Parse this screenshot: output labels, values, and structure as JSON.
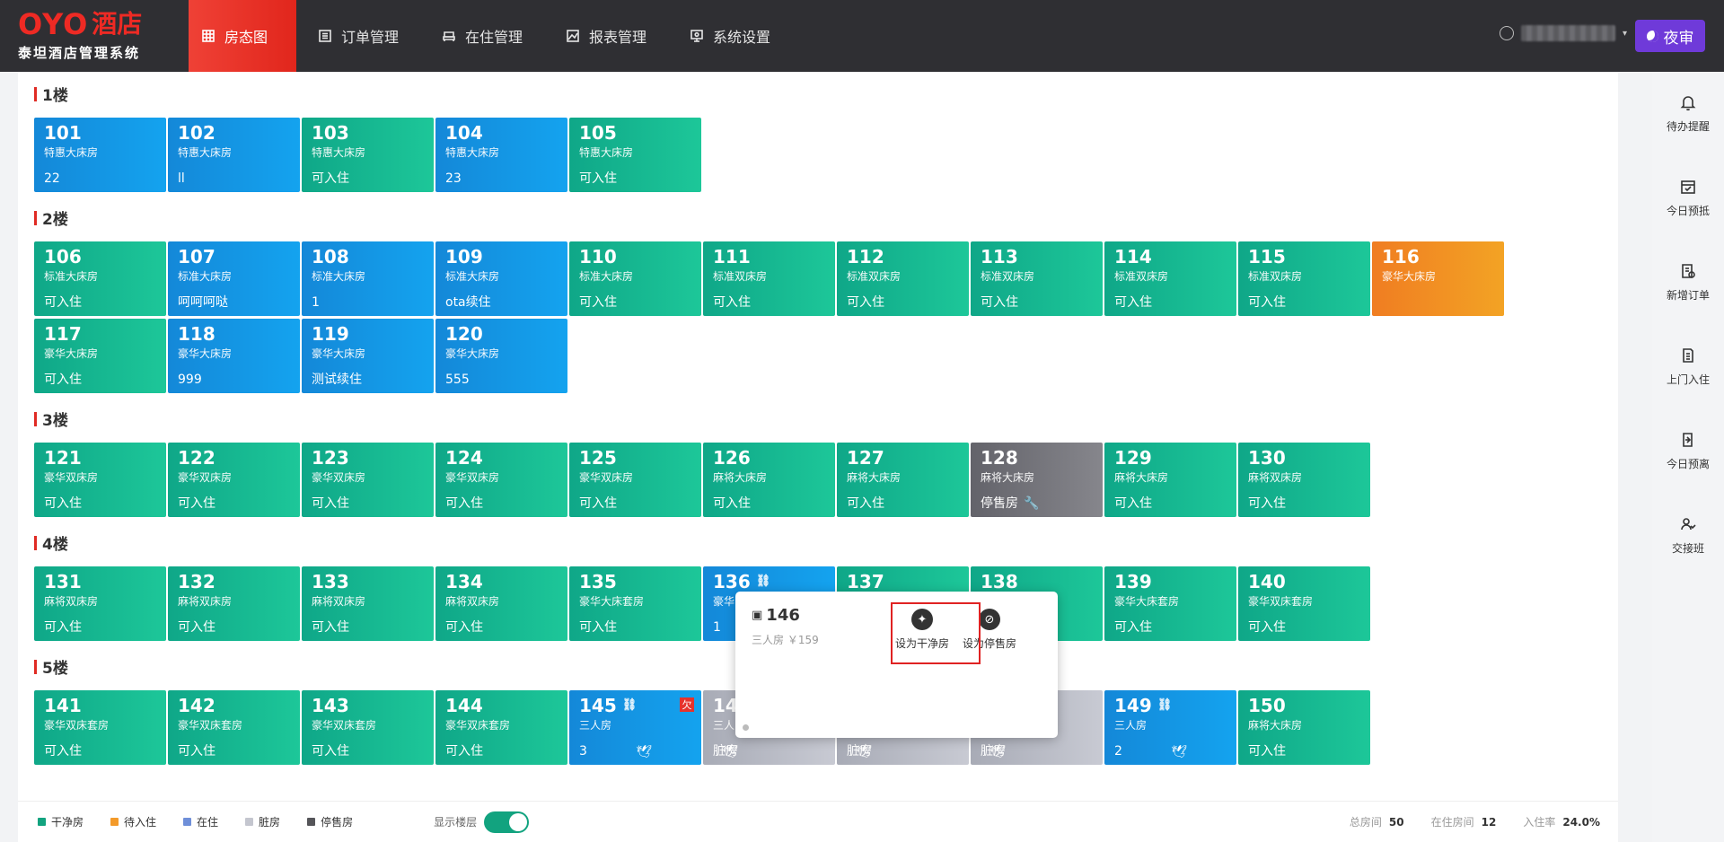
{
  "brand": {
    "oyo": "OYO",
    "hotel": "酒店",
    "sub": "泰坦酒店管理系统"
  },
  "nav": [
    {
      "label": "房态图",
      "icon": "grid-icon",
      "active": true
    },
    {
      "label": "订单管理",
      "icon": "list-icon"
    },
    {
      "label": "在住管理",
      "icon": "bed-icon"
    },
    {
      "label": "报表管理",
      "icon": "chart-icon"
    },
    {
      "label": "系统设置",
      "icon": "settings-icon"
    }
  ],
  "user": {
    "caret": "▾"
  },
  "night_button": "夜审",
  "floors": [
    {
      "title": "1楼",
      "rooms": [
        {
          "num": "101",
          "type": "特惠大床房",
          "status": "22",
          "color": "b"
        },
        {
          "num": "102",
          "type": "特惠大床房",
          "status": "ll",
          "color": "b"
        },
        {
          "num": "103",
          "type": "特惠大床房",
          "status": "可入住",
          "color": "g"
        },
        {
          "num": "104",
          "type": "特惠大床房",
          "status": "23",
          "color": "b"
        },
        {
          "num": "105",
          "type": "特惠大床房",
          "status": "可入住",
          "color": "g"
        }
      ]
    },
    {
      "title": "2楼",
      "rooms": [
        {
          "num": "106",
          "type": "标准大床房",
          "status": "可入住",
          "color": "g"
        },
        {
          "num": "107",
          "type": "标准大床房",
          "status": "呵呵呵哒",
          "color": "b"
        },
        {
          "num": "108",
          "type": "标准大床房",
          "status": "1",
          "color": "b"
        },
        {
          "num": "109",
          "type": "标准大床房",
          "status": "ota续住",
          "color": "b"
        },
        {
          "num": "110",
          "type": "标准大床房",
          "status": "可入住",
          "color": "g"
        },
        {
          "num": "111",
          "type": "标准双床房",
          "status": "可入住",
          "color": "g"
        },
        {
          "num": "112",
          "type": "标准双床房",
          "status": "可入住",
          "color": "g"
        },
        {
          "num": "113",
          "type": "标准双床房",
          "status": "可入住",
          "color": "g"
        },
        {
          "num": "114",
          "type": "标准双床房",
          "status": "可入住",
          "color": "g"
        },
        {
          "num": "115",
          "type": "标准双床房",
          "status": "可入住",
          "color": "g"
        },
        {
          "num": "116",
          "type": "豪华大床房",
          "status": "",
          "color": "o"
        },
        {
          "num": "117",
          "type": "豪华大床房",
          "status": "可入住",
          "color": "g"
        },
        {
          "num": "118",
          "type": "豪华大床房",
          "status": "999",
          "color": "b"
        },
        {
          "num": "119",
          "type": "豪华大床房",
          "status": "测试续住",
          "color": "b"
        },
        {
          "num": "120",
          "type": "豪华大床房",
          "status": "555",
          "color": "b"
        }
      ]
    },
    {
      "title": "3楼",
      "rooms": [
        {
          "num": "121",
          "type": "豪华双床房",
          "status": "可入住",
          "color": "g"
        },
        {
          "num": "122",
          "type": "豪华双床房",
          "status": "可入住",
          "color": "g"
        },
        {
          "num": "123",
          "type": "豪华双床房",
          "status": "可入住",
          "color": "g"
        },
        {
          "num": "124",
          "type": "豪华双床房",
          "status": "可入住",
          "color": "g"
        },
        {
          "num": "125",
          "type": "豪华双床房",
          "status": "可入住",
          "color": "g"
        },
        {
          "num": "126",
          "type": "麻将大床房",
          "status": "可入住",
          "color": "g"
        },
        {
          "num": "127",
          "type": "麻将大床房",
          "status": "可入住",
          "color": "g"
        },
        {
          "num": "128",
          "type": "麻将大床房",
          "status": "停售房",
          "color": "d",
          "wrench": true
        },
        {
          "num": "129",
          "type": "麻将大床房",
          "status": "可入住",
          "color": "g"
        },
        {
          "num": "130",
          "type": "麻将双床房",
          "status": "可入住",
          "color": "g"
        }
      ]
    },
    {
      "title": "4楼",
      "rooms": [
        {
          "num": "131",
          "type": "麻将双床房",
          "status": "可入住",
          "color": "g"
        },
        {
          "num": "132",
          "type": "麻将双床房",
          "status": "可入住",
          "color": "g"
        },
        {
          "num": "133",
          "type": "麻将双床房",
          "status": "可入住",
          "color": "g"
        },
        {
          "num": "134",
          "type": "麻将双床房",
          "status": "可入住",
          "color": "g"
        },
        {
          "num": "135",
          "type": "豪华大床套房",
          "status": "可入住",
          "color": "g"
        },
        {
          "num": "136",
          "type": "豪华",
          "status": "1",
          "color": "b",
          "link": true
        },
        {
          "num": "137",
          "type": "",
          "status": "",
          "color": "g"
        },
        {
          "num": "138",
          "type": "",
          "status": "",
          "color": "g"
        },
        {
          "num": "139",
          "type": "豪华大床套房",
          "status": "可入住",
          "color": "g"
        },
        {
          "num": "140",
          "type": "豪华双床套房",
          "status": "可入住",
          "color": "g"
        }
      ]
    },
    {
      "title": "5楼",
      "rooms": [
        {
          "num": "141",
          "type": "豪华双床套房",
          "status": "可入住",
          "color": "g"
        },
        {
          "num": "142",
          "type": "豪华双床套房",
          "status": "可入住",
          "color": "g"
        },
        {
          "num": "143",
          "type": "豪华双床套房",
          "status": "可入住",
          "color": "g"
        },
        {
          "num": "144",
          "type": "豪华双床套房",
          "status": "可入住",
          "color": "g"
        },
        {
          "num": "145",
          "type": "三人房",
          "status": "3",
          "color": "b",
          "link": true,
          "debt": "欠",
          "bird": true
        },
        {
          "num": "14",
          "type": "三人",
          "status": "脏房",
          "color": "l",
          "bird": true
        },
        {
          "num": "",
          "type": "",
          "status": "脏房",
          "color": "l",
          "bird": true
        },
        {
          "num": "",
          "type": "",
          "status": "脏房",
          "color": "l",
          "bird": true
        },
        {
          "num": "149",
          "type": "三人房",
          "status": "2",
          "color": "b",
          "link": true,
          "bird": true
        },
        {
          "num": "150",
          "type": "麻将大床房",
          "status": "可入住",
          "color": "g"
        }
      ]
    }
  ],
  "popup": {
    "room": "146",
    "sub": "三人房 ￥159",
    "action_clean": "设为干净房",
    "action_stop": "设为停售房"
  },
  "legend": [
    {
      "label": "干净房",
      "color": "#12a37f"
    },
    {
      "label": "待入住",
      "color": "#f39a2a"
    },
    {
      "label": "在住",
      "color": "#6f8fd9"
    },
    {
      "label": "脏房",
      "color": "#c4c6cf"
    },
    {
      "label": "停售房",
      "color": "#555559"
    }
  ],
  "toggle_label": "显示楼层",
  "stats": [
    {
      "label": "总房间",
      "value": "50"
    },
    {
      "label": "在住房间",
      "value": "12"
    },
    {
      "label": "入住率",
      "value": "24.0%"
    }
  ],
  "sidebar": [
    {
      "label": "待办提醒",
      "icon": "bell-icon"
    },
    {
      "label": "今日预抵",
      "icon": "calendar-icon"
    },
    {
      "label": "新增订单",
      "icon": "new-order-icon"
    },
    {
      "label": "上门入住",
      "icon": "checkin-icon"
    },
    {
      "label": "今日预离",
      "icon": "checkout-icon"
    },
    {
      "label": "交接班",
      "icon": "handover-icon"
    }
  ]
}
